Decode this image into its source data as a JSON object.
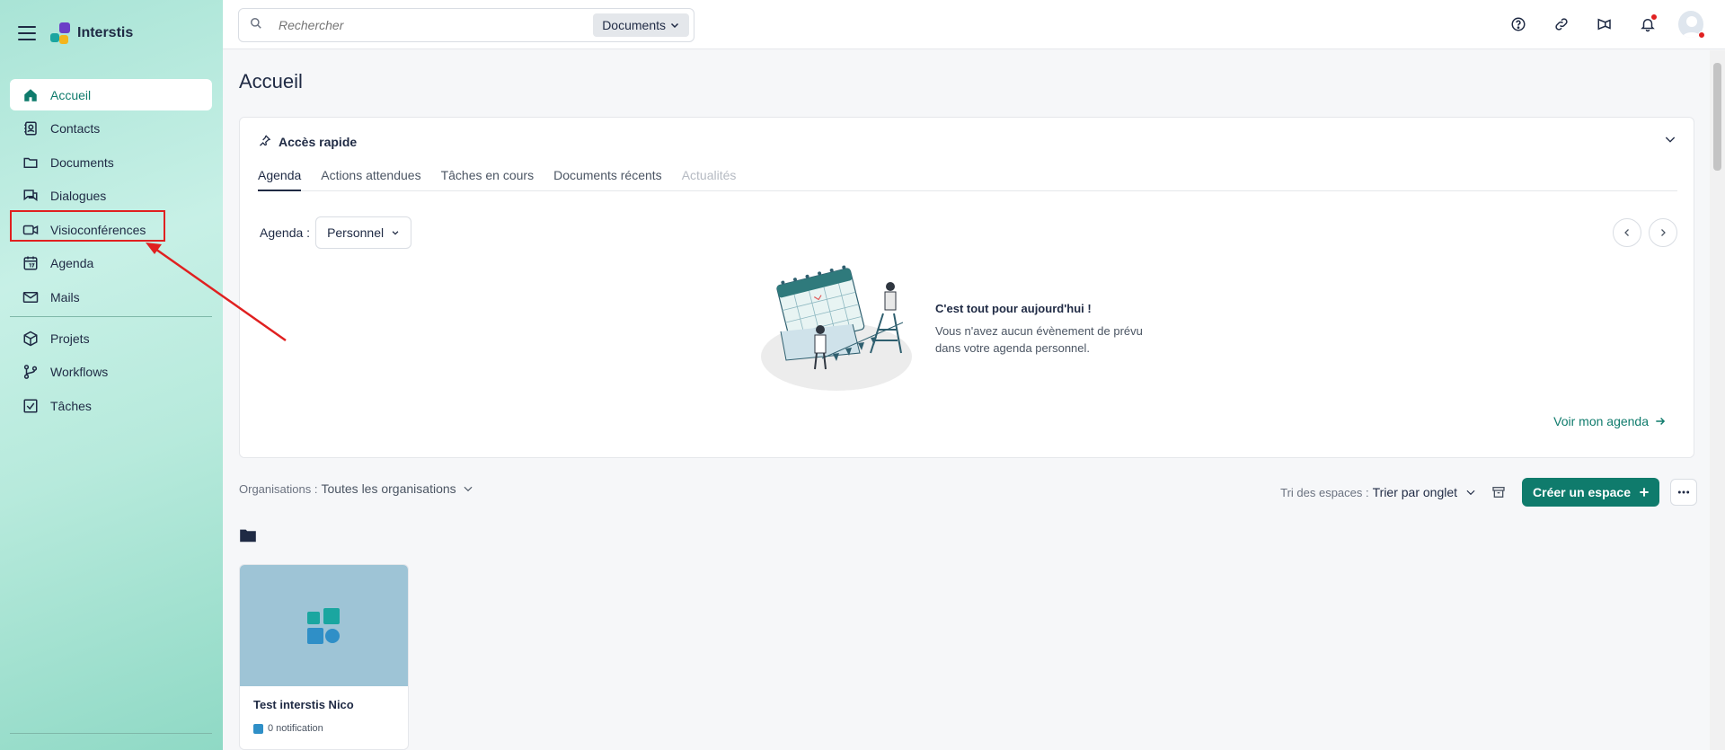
{
  "app": {
    "name": "Interstis"
  },
  "sidebar": {
    "items": [
      {
        "label": "Accueil",
        "icon": "home-icon",
        "active": true
      },
      {
        "label": "Contacts",
        "icon": "contacts-icon"
      },
      {
        "label": "Documents",
        "icon": "folder-icon"
      },
      {
        "label": "Dialogues",
        "icon": "chat-icon"
      },
      {
        "label": "Visioconférences",
        "icon": "video-icon"
      },
      {
        "label": "Agenda",
        "icon": "calendar-icon"
      },
      {
        "label": "Mails",
        "icon": "mail-icon"
      },
      {
        "label": "Projets",
        "icon": "cube-icon"
      },
      {
        "label": "Workflows",
        "icon": "workflow-icon"
      },
      {
        "label": "Tâches",
        "icon": "checkbox-icon"
      }
    ]
  },
  "search": {
    "placeholder": "Rechercher",
    "scope": "Documents"
  },
  "page": {
    "title": "Accueil"
  },
  "quick_access": {
    "title": "Accès rapide",
    "tabs": [
      "Agenda",
      "Actions attendues",
      "Tâches en cours",
      "Documents récents",
      "Actualités"
    ],
    "agenda_label": "Agenda :",
    "agenda_select": "Personnel",
    "empty_title": "C'est tout pour aujourd'hui !",
    "empty_text": "Vous n'avez aucun évènement de prévu dans votre agenda personnel.",
    "see_agenda": "Voir mon agenda"
  },
  "filters": {
    "org_label": "Organisations :",
    "org_value": "Toutes les organisations",
    "sort_label": "Tri des espaces :",
    "sort_value": "Trier par onglet",
    "create_label": "Créer un espace"
  },
  "spaces": [
    {
      "name": "Test interstis Nico",
      "notifications": "0 notification"
    }
  ],
  "colors": {
    "accent": "#0f7b6c",
    "highlight": "#e02020",
    "space_cover": "#9ec4d6"
  }
}
